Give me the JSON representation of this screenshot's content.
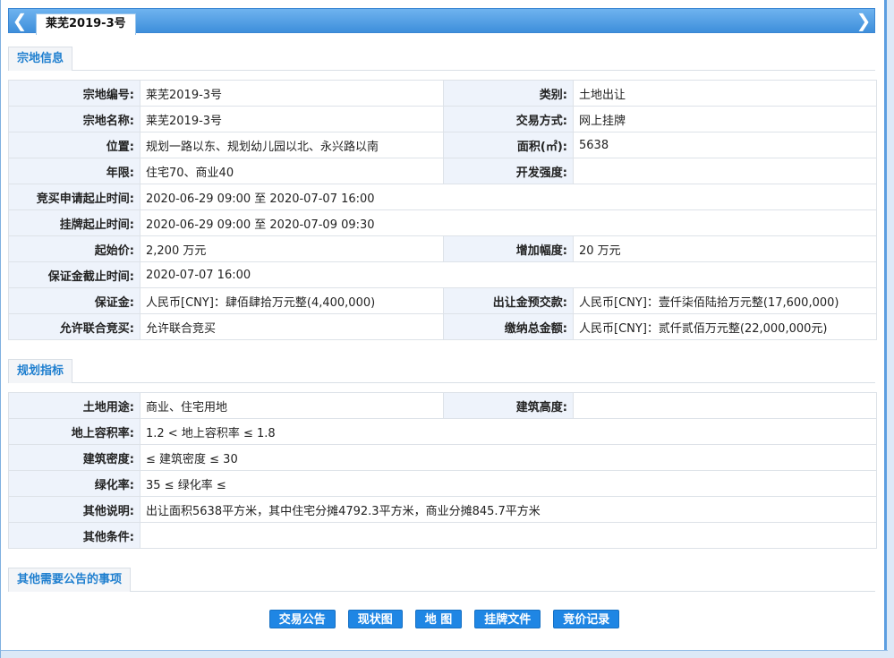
{
  "tab": {
    "title": "莱芜2019-3号",
    "prev_glyph": "❮",
    "next_glyph": "❯"
  },
  "sections": {
    "parcel": "宗地信息",
    "planning": "规划指标",
    "other": "其他需要公告的事项"
  },
  "parcel": {
    "code_label": "宗地编号:",
    "code": "莱芜2019-3号",
    "category_label": "类别:",
    "category": "土地出让",
    "name_label": "宗地名称:",
    "name": "莱芜2019-3号",
    "trade_label": "交易方式:",
    "trade": "网上挂牌",
    "location_label": "位置:",
    "location": "规划一路以东、规划幼儿园以北、永兴路以南",
    "area_label": "面积(㎡):",
    "area": "5638",
    "term_label": "年限:",
    "term": "住宅70、商业40",
    "intensity_label": "开发强度:",
    "intensity": "",
    "bid_apply_label": "竞买申请起止时间:",
    "bid_apply": "2020-06-29 09:00 至 2020-07-07 16:00",
    "listing_label": "挂牌起止时间:",
    "listing": "2020-06-29 09:00 至 2020-07-09 09:30",
    "start_price_label": "起始价:",
    "start_price": "2,200 万元",
    "increment_label": "增加幅度:",
    "increment": "20 万元",
    "deposit_deadline_label": "保证金截止时间:",
    "deposit_deadline": "2020-07-07 16:00",
    "deposit_label": "保证金:",
    "deposit": "人民币[CNY]：肆佰肆拾万元整(4,400,000)",
    "prepay_label": "出让金预交款:",
    "prepay": "人民币[CNY]：壹仟柒佰陆拾万元整(17,600,000)",
    "joint_label": "允许联合竞买:",
    "joint": "允许联合竞买",
    "total_label": "缴纳总金额:",
    "total": "人民币[CNY]：贰仟贰佰万元整(22,000,000元)"
  },
  "planning": {
    "use_label": "土地用途:",
    "use": "商业、住宅用地",
    "height_label": "建筑高度:",
    "height": "",
    "far_label": "地上容积率:",
    "far": "1.2 < 地上容积率 ≤ 1.8",
    "density_label": "建筑密度:",
    "density": "≤ 建筑密度 ≤ 30",
    "green_label": "绿化率:",
    "green": "35 ≤ 绿化率 ≤",
    "notes_label": "其他说明:",
    "notes": "出让面积5638平方米，其中住宅分摊4792.3平方米，商业分摊845.7平方米",
    "conditions_label": "其他条件:",
    "conditions": ""
  },
  "buttons": {
    "announcement": "交易公告",
    "status_map": "现状图",
    "map": "地 图",
    "listing_docs": "挂牌文件",
    "bid_records": "竞价记录"
  },
  "colors": {
    "accent": "#1f86e4",
    "label_bg": "#eef3fb",
    "section_text": "#1f7fcf"
  }
}
